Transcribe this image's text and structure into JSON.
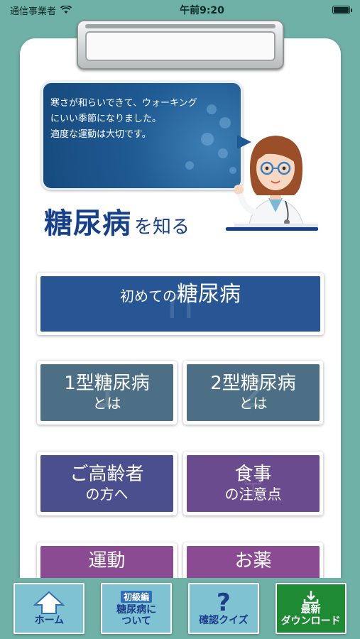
{
  "status_bar": {
    "carrier": "通信事業者",
    "time": "午前9:20"
  },
  "bubble": {
    "lines": [
      "寒さが和らいできて、ウォーキング",
      "にいい季節になりました。",
      "適度な運動は大切です。"
    ]
  },
  "heading": {
    "main": "糖尿病",
    "sub": "を知る"
  },
  "menu": {
    "first": {
      "small": "初めての",
      "big": "糖尿病"
    },
    "type1": {
      "l1": "1型糖尿病",
      "l2": "とは"
    },
    "type2": {
      "l1": "2型糖尿病",
      "l2": "とは"
    },
    "elderly": {
      "l1": "ご高齢者",
      "l2": "の方へ"
    },
    "diet": {
      "l1": "食事",
      "l2": "の注意点"
    },
    "exercise": {
      "l1": "運動"
    },
    "medicine": {
      "l1": "お薬"
    }
  },
  "tabbar": {
    "home": "ホーム",
    "beginner_tag": "初級編",
    "beginner_l1": "糖尿病に",
    "beginner_l2": "ついて",
    "quiz_icon": "?",
    "quiz": "確認クイズ",
    "download_l1": "最新",
    "download_l2": "ダウンロード"
  },
  "icons": {
    "wifi": "wifi-icon",
    "battery": "battery-icon",
    "home": "house-arrow-icon",
    "download": "download-icon"
  },
  "colors": {
    "background": "#6fb1a6",
    "heading": "#16418a",
    "button_blue": "#285594",
    "download_green": "#1e8a33"
  }
}
